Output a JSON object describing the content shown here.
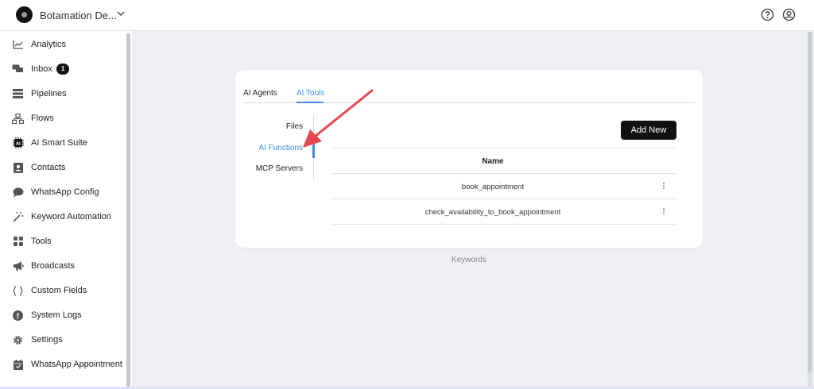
{
  "header": {
    "workspace_name": "Botamation De...",
    "icons": [
      "help-circle-icon",
      "account-circle-icon"
    ]
  },
  "sidebar": {
    "items": [
      {
        "label": "Analytics",
        "icon": "analytics-icon"
      },
      {
        "label": "Inbox",
        "icon": "chat-icon",
        "badge": "1"
      },
      {
        "label": "Pipelines",
        "icon": "pipelines-icon"
      },
      {
        "label": "Flows",
        "icon": "flows-icon"
      },
      {
        "label": "AI Smart Suite",
        "icon": "ai-chip-icon"
      },
      {
        "label": "Contacts",
        "icon": "contacts-icon"
      },
      {
        "label": "WhatsApp Config",
        "icon": "whatsapp-icon"
      },
      {
        "label": "Keyword Automation",
        "icon": "magic-wand-icon"
      },
      {
        "label": "Tools",
        "icon": "grid-icon"
      },
      {
        "label": "Broadcasts",
        "icon": "megaphone-icon"
      },
      {
        "label": "Custom Fields",
        "icon": "braces-icon"
      },
      {
        "label": "System Logs",
        "icon": "alert-icon"
      },
      {
        "label": "Settings",
        "icon": "gear-icon"
      },
      {
        "label": "WhatsApp Appointment",
        "icon": "calendar-check-icon"
      }
    ]
  },
  "main": {
    "tabs": [
      {
        "label": "AI Agents",
        "active": false
      },
      {
        "label": "AI Tools",
        "active": true
      }
    ],
    "subnav": [
      {
        "label": "Files",
        "active": false
      },
      {
        "label": "AI Functions",
        "active": true
      },
      {
        "label": "MCP Servers",
        "active": false
      }
    ],
    "add_button": "Add New",
    "table": {
      "column": "Name",
      "rows": [
        "book_appointment",
        "check_availability_to_book_appointment"
      ]
    },
    "footer_label": "Keywords"
  },
  "colors": {
    "accent": "#3b8fe0",
    "annotation_arrow": "#e5484d"
  }
}
